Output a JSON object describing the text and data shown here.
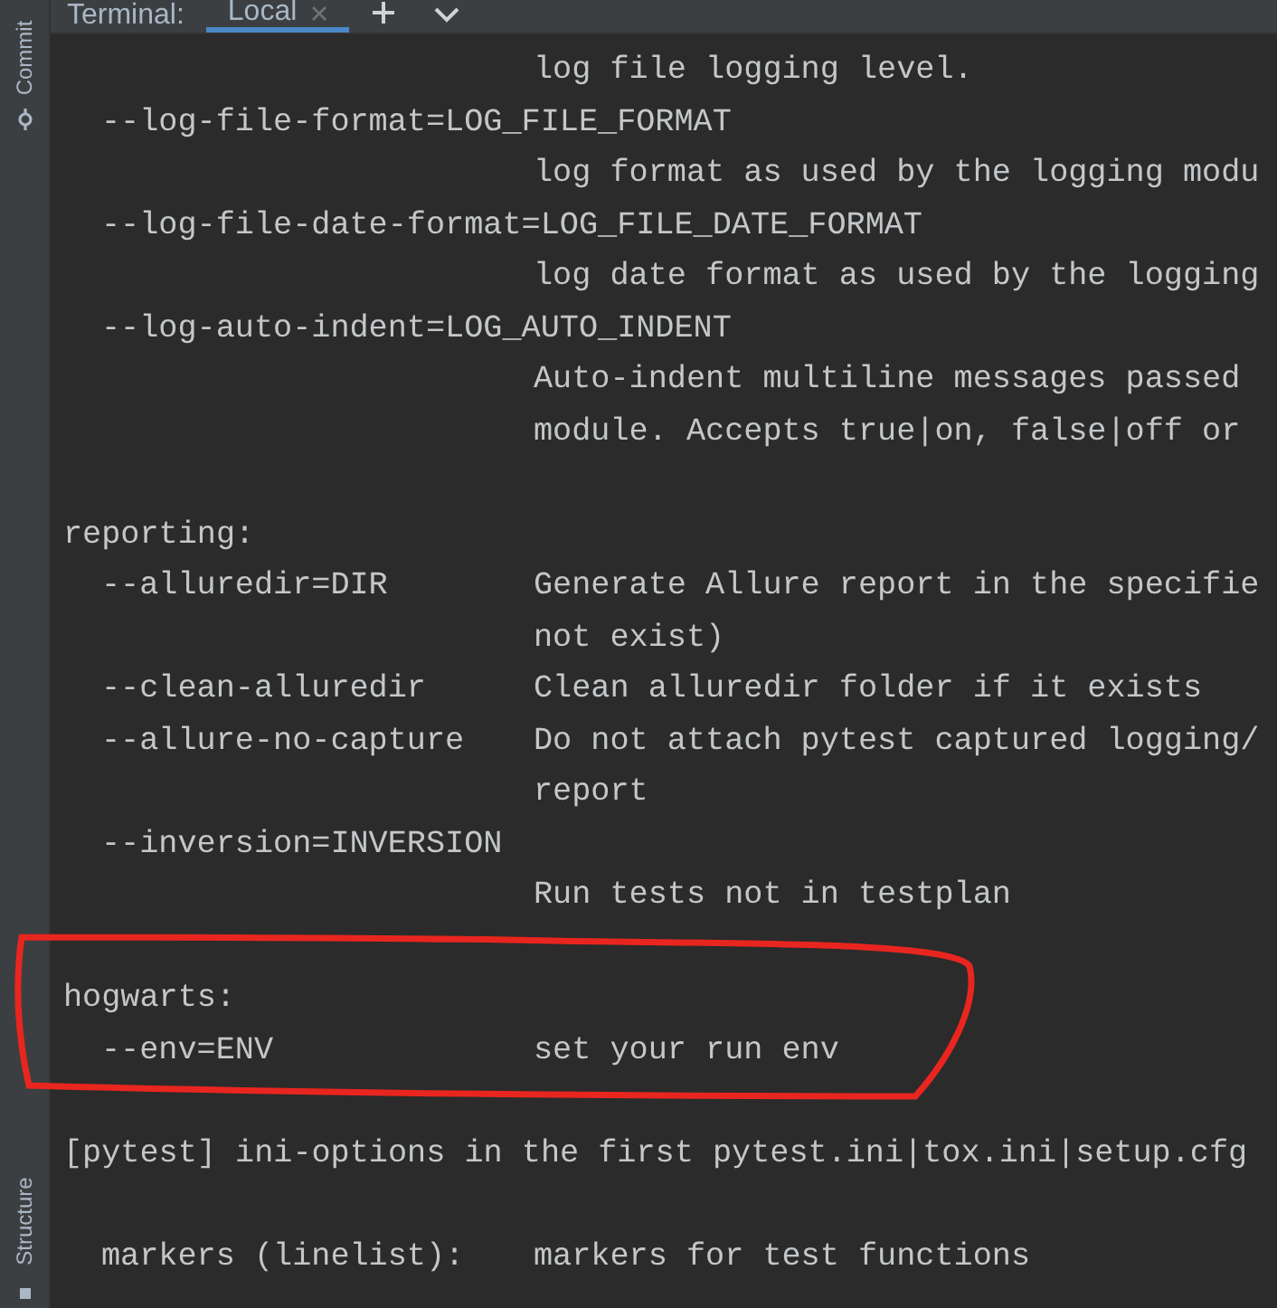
{
  "sidebar": {
    "top_tab": {
      "label": "Commit"
    },
    "bottom_tab": {
      "label": "Structure"
    }
  },
  "terminal_header": {
    "title": "Terminal:",
    "tabs": [
      {
        "label": "Local",
        "selected": true,
        "closable": true
      }
    ]
  },
  "lines": [
    {
      "kind": "option",
      "description": "log file logging level."
    },
    {
      "kind": "option",
      "option": "--log-file-format=LOG_FILE_FORMAT"
    },
    {
      "kind": "option",
      "description": "log format as used by the logging modu"
    },
    {
      "kind": "option",
      "option": "--log-file-date-format=LOG_FILE_DATE_FORMAT"
    },
    {
      "kind": "option",
      "description": "log date format as used by the logging"
    },
    {
      "kind": "option",
      "option": "--log-auto-indent=LOG_AUTO_INDENT"
    },
    {
      "kind": "option",
      "description": "Auto-indent multiline messages passed"
    },
    {
      "kind": "option",
      "description": "module. Accepts true|on, false|off or"
    },
    {
      "kind": "blank"
    },
    {
      "kind": "section",
      "text": "reporting:"
    },
    {
      "kind": "option",
      "option": "--alluredir=DIR",
      "description": "Generate Allure report in the specifie"
    },
    {
      "kind": "option",
      "description": "not exist)"
    },
    {
      "kind": "option",
      "option": "--clean-alluredir",
      "description": "Clean alluredir folder if it exists"
    },
    {
      "kind": "option",
      "option": "--allure-no-capture",
      "description": "Do not attach pytest captured logging/"
    },
    {
      "kind": "option",
      "description": "report"
    },
    {
      "kind": "option",
      "option": "--inversion=INVERSION"
    },
    {
      "kind": "option",
      "description": "Run tests not in testplan"
    },
    {
      "kind": "blank"
    },
    {
      "kind": "section",
      "text": "hogwarts:"
    },
    {
      "kind": "option",
      "option": "--env=ENV",
      "description": "set your run env"
    },
    {
      "kind": "blank"
    },
    {
      "kind": "section",
      "text": "[pytest] ini-options in the first pytest.ini|tox.ini|setup.cfg"
    },
    {
      "kind": "blank"
    },
    {
      "kind": "option",
      "option": "markers (linelist):",
      "description": "markers for test functions"
    }
  ],
  "annotation": {
    "kind": "freehand_loop"
  }
}
